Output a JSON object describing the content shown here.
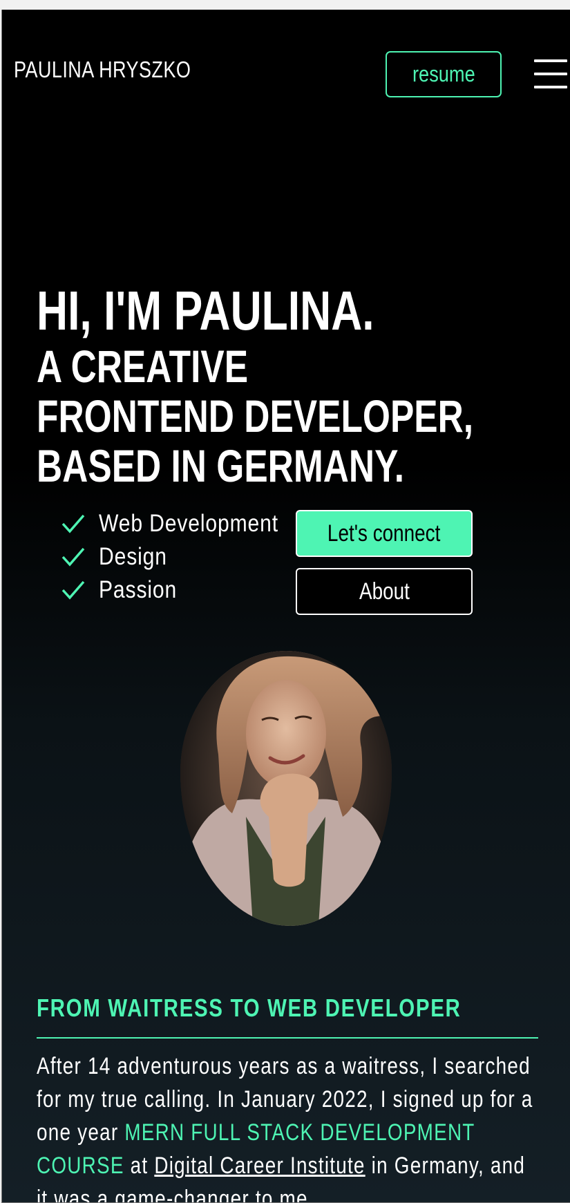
{
  "header": {
    "brand": "PAULINA HRYSZKO",
    "resume_label": "resume",
    "menu_icon": "hamburger-menu-icon"
  },
  "hero": {
    "greeting": "HI, I'M PAULINA.",
    "line2": "A CREATIVE",
    "line3": "FRONTEND DEVELOPER,",
    "line4": "BASED IN GERMANY."
  },
  "skills": [
    {
      "icon": "checkmark-icon",
      "label": "Web Development"
    },
    {
      "icon": "checkmark-icon",
      "label": "Design"
    },
    {
      "icon": "checkmark-icon",
      "label": "Passion"
    }
  ],
  "actions": {
    "connect_label": "Let's connect",
    "about_label": "About"
  },
  "about": {
    "title": "FROM WAITRESS TO WEB DEVELOPER",
    "text_part1": "After 14 adventurous years as a waitress, I searched for my true calling. In January 2022, I signed up for a one year ",
    "highlight": "MERN FULL STACK DEVELOPMENT COURSE",
    "text_part2": " at ",
    "link": "Digital Career Institute",
    "text_part3": " in Germany, and it was a game-changer to me."
  },
  "colors": {
    "accent": "#4ef4b3",
    "background": "#000000",
    "text": "#ffffff"
  }
}
